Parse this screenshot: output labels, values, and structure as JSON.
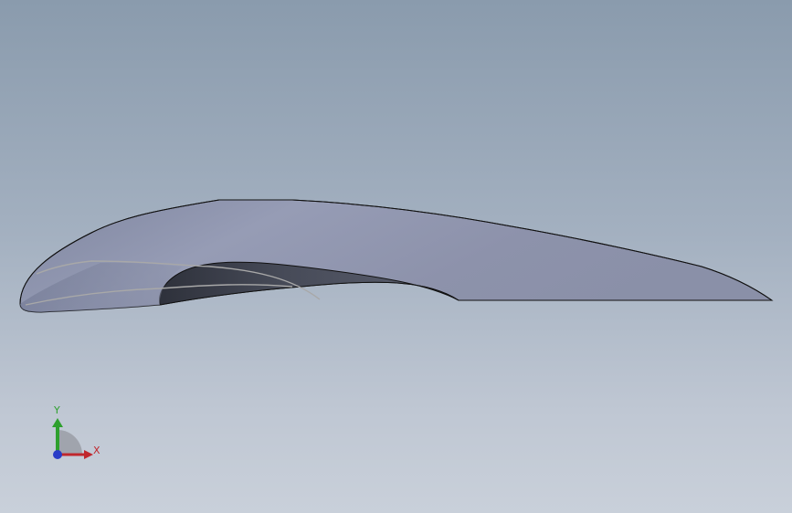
{
  "viewport": {
    "background_top": "#8a9bad",
    "background_bottom": "#c9d0da"
  },
  "model": {
    "surface_color": "#8e95ad",
    "inner_surface_color": "#3f434f",
    "edge_color": "#111111"
  },
  "triad": {
    "y_label": "Y",
    "x_label": "X",
    "y_color": "#2ea02e",
    "x_color": "#c0272d",
    "z_color": "#2a3cc8"
  }
}
